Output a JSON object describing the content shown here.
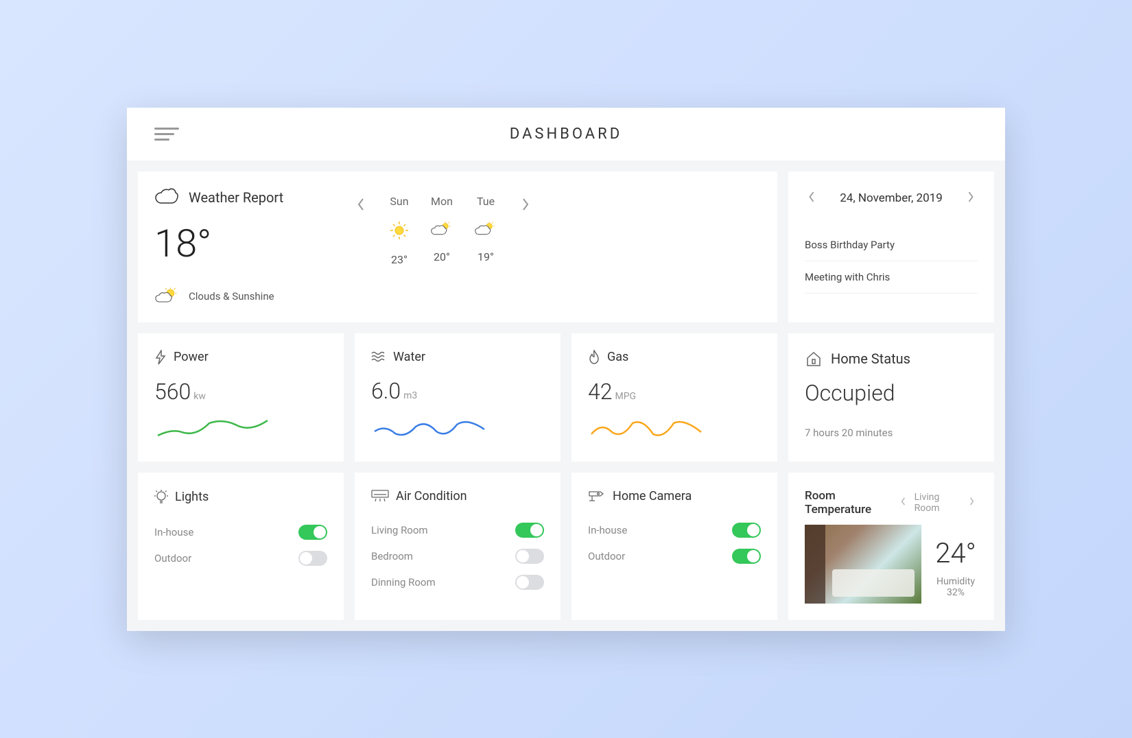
{
  "header": {
    "title": "DASHBOARD"
  },
  "weather": {
    "title": "Weather Report",
    "current_temp": "18°",
    "condition": "Clouds & Sunshine",
    "forecast": [
      {
        "day": "Sun",
        "temp": "23°",
        "icon": "sunny"
      },
      {
        "day": "Mon",
        "temp": "20°",
        "icon": "partly-cloudy"
      },
      {
        "day": "Tue",
        "temp": "19°",
        "icon": "partly-cloudy"
      }
    ]
  },
  "calendar": {
    "date": "24, November, 2019",
    "events": [
      {
        "title": "Boss Birthday Party"
      },
      {
        "title": "Meeting with Chris"
      }
    ]
  },
  "metrics": {
    "power": {
      "title": "Power",
      "value": "560",
      "unit": "kw",
      "color": "#3db84a"
    },
    "water": {
      "title": "Water",
      "value": "6.0",
      "unit": "m3",
      "color": "#3a7ee6"
    },
    "gas": {
      "title": "Gas",
      "value": "42",
      "unit": "MPG",
      "color": "#faa61a"
    }
  },
  "home_status": {
    "title": "Home Status",
    "value": "Occupied",
    "duration": "7 hours 20 minutes"
  },
  "lights": {
    "title": "Lights",
    "items": [
      {
        "label": "In-house",
        "on": true
      },
      {
        "label": "Outdoor",
        "on": false
      }
    ]
  },
  "ac": {
    "title": "Air Condition",
    "items": [
      {
        "label": "Living Room",
        "on": true
      },
      {
        "label": "Bedroom",
        "on": false
      },
      {
        "label": "Dinning Room",
        "on": false
      }
    ]
  },
  "camera": {
    "title": "Home Camera",
    "items": [
      {
        "label": "In-house",
        "on": true
      },
      {
        "label": "Outdoor",
        "on": true
      }
    ]
  },
  "room_temp": {
    "title": "Room Temperature",
    "room": "Living Room",
    "temp": "24°",
    "humidity": "Humidity 32%"
  },
  "chart_data": [
    {
      "type": "line",
      "name": "power",
      "values": [
        20,
        30,
        25,
        50,
        40,
        60,
        30
      ],
      "color": "#3db84a"
    },
    {
      "type": "line",
      "name": "water",
      "values": [
        30,
        40,
        25,
        45,
        20,
        50,
        35
      ],
      "color": "#3a7ee6"
    },
    {
      "type": "line",
      "name": "gas",
      "values": [
        25,
        50,
        30,
        55,
        25,
        50,
        30
      ],
      "color": "#faa61a"
    }
  ]
}
